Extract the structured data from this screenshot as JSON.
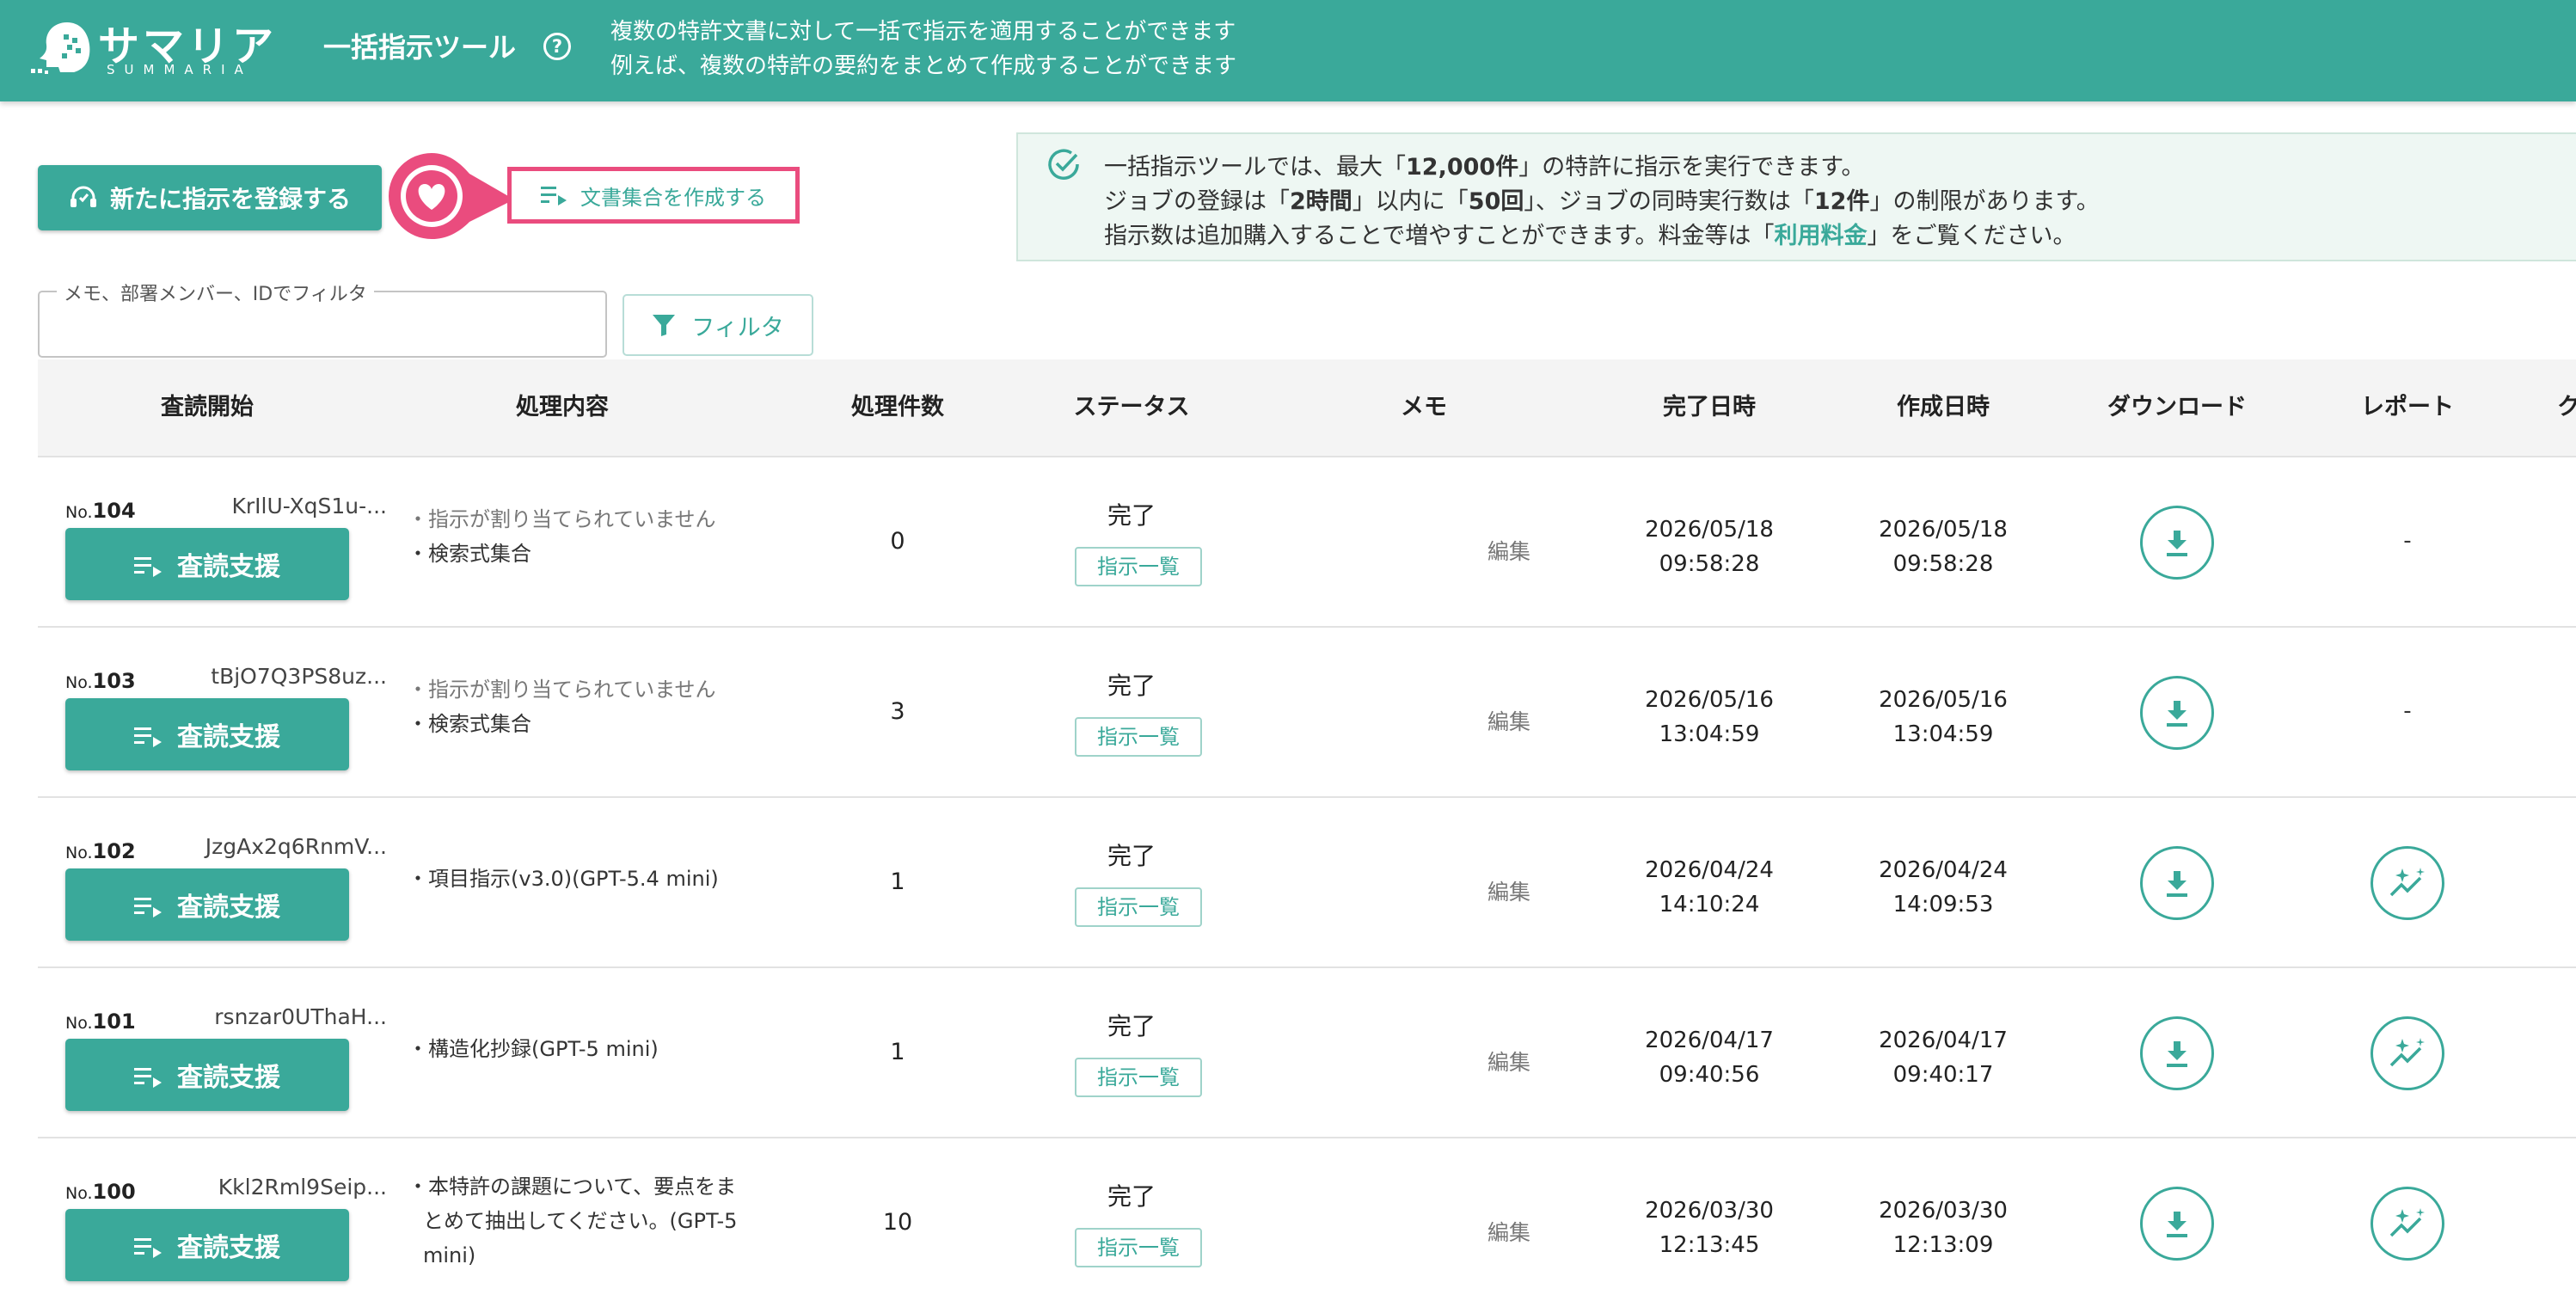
{
  "header": {
    "logo_ja": "サマリア",
    "logo_en": "SUMMARIA",
    "app_title": "一括指示ツール",
    "help_symbol": "?",
    "desc_line1": "複数の特許文書に対して一括で指示を適用することができます",
    "desc_line2": "例えば、複数の特許の要約をまとめて作成することができます"
  },
  "toolbar": {
    "register_label": "新たに指示を登録する",
    "create_set_label": "文書集合を作成する"
  },
  "info": {
    "l1_a": "一括指示ツールでは、最大「",
    "l1_b": "12,000件",
    "l1_c": "」の特許に指示を実行できます。",
    "l2_a": "ジョブの登録は「",
    "l2_b": "2時間",
    "l2_c": "」以内に「",
    "l2_d": "50回",
    "l2_e": "」、ジョブの同時実行数は「",
    "l2_f": "12件",
    "l2_g": "」の制限があります。",
    "l3_a": "指示数は追加購入することで増やすことができます。料金等は「",
    "l3_link": "利用料金",
    "l3_b": "」をご覧ください。"
  },
  "filter": {
    "label": "メモ、部署メンバー、IDでフィルタ",
    "value": "",
    "button_label": "フィルタ"
  },
  "table": {
    "columns": [
      "査読開始",
      "処理内容",
      "処理件数",
      "ステータス",
      "メモ",
      "完了日時",
      "作成日時",
      "ダウンロード",
      "レポート",
      "ク"
    ],
    "rows": [
      {
        "no_prefix": "No.",
        "no": "104",
        "hash": "KrIlU-XqS1u-...",
        "action": "査読支援",
        "proc_line1": "・指示が割り当てられていません",
        "proc_line2": "・検索式集合",
        "count": "0",
        "status": "完了",
        "list_label": "指示一覧",
        "memo": "編集",
        "done_date": "2026/05/18",
        "done_time": "09:58:28",
        "created_date": "2026/05/18",
        "created_time": "09:58:28",
        "report": "-"
      },
      {
        "no_prefix": "No.",
        "no": "103",
        "hash": "tBjO7Q3PS8uz...",
        "action": "査読支援",
        "proc_line1": "・指示が割り当てられていません",
        "proc_line2": "・検索式集合",
        "count": "3",
        "status": "完了",
        "list_label": "指示一覧",
        "memo": "編集",
        "done_date": "2026/05/16",
        "done_time": "13:04:59",
        "created_date": "2026/05/16",
        "created_time": "13:04:59",
        "report": "-"
      },
      {
        "no_prefix": "No.",
        "no": "102",
        "hash": "JzgAx2q6RnmV...",
        "action": "査読支援",
        "proc_line1": "・項目指示(v3.0)(GPT-5.4 mini)",
        "count": "1",
        "status": "完了",
        "list_label": "指示一覧",
        "memo": "編集",
        "done_date": "2026/04/24",
        "done_time": "14:10:24",
        "created_date": "2026/04/24",
        "created_time": "14:09:53",
        "report_icon": "sparkle-chart-icon"
      },
      {
        "no_prefix": "No.",
        "no": "101",
        "hash": "rsnzar0UThaH...",
        "action": "査読支援",
        "proc_line1": "・構造化抄録(GPT-5 mini)",
        "count": "1",
        "status": "完了",
        "list_label": "指示一覧",
        "memo": "編集",
        "done_date": "2026/04/17",
        "done_time": "09:40:56",
        "created_date": "2026/04/17",
        "created_time": "09:40:17",
        "report_icon": "sparkle-chart-icon"
      },
      {
        "no_prefix": "No.",
        "no": "100",
        "hash": "Kkl2Rml9Seip...",
        "action": "査読支援",
        "proc_line1": "・本特許の課題について、要点をま",
        "proc_line2": "とめて抽出してください。(GPT-5",
        "proc_line3": "mini)",
        "count": "10",
        "status": "完了",
        "list_label": "指示一覧",
        "memo": "編集",
        "done_date": "2026/03/30",
        "done_time": "12:13:45",
        "created_date": "2026/03/30",
        "created_time": "12:13:09",
        "report_icon": "sparkle-chart-icon"
      }
    ]
  },
  "colors": {
    "brand": "#3aa99a",
    "highlight": "#ea4c7e",
    "info_bg": "#eef7f3"
  }
}
